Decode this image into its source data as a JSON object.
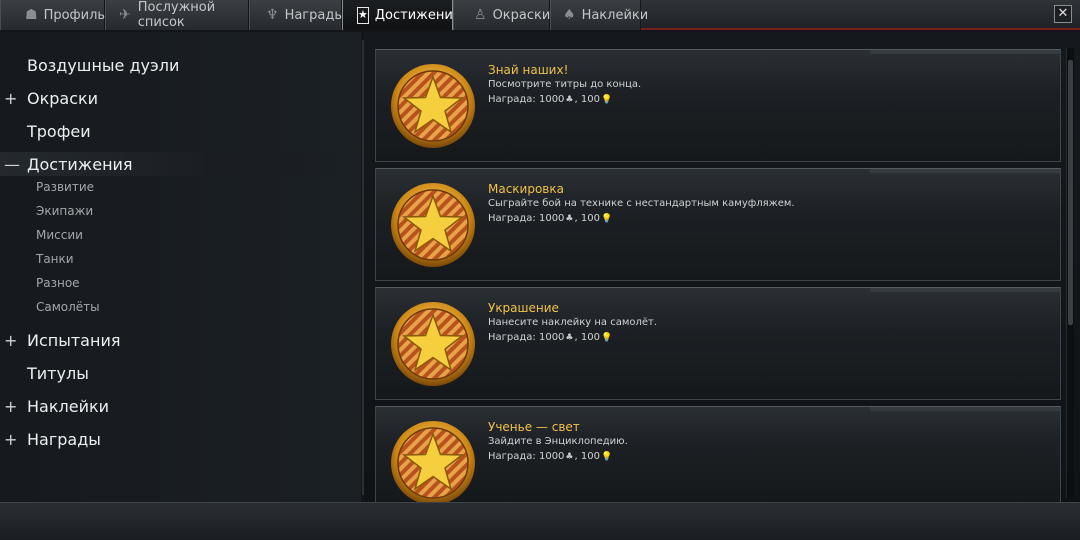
{
  "tabs": [
    {
      "label": "Профиль",
      "icon": "soldier-icon",
      "glyph": "☗"
    },
    {
      "label": "Послужной список",
      "icon": "aircraft-icon",
      "glyph": "✈"
    },
    {
      "label": "Награды",
      "icon": "goblet-icon",
      "glyph": "♆"
    },
    {
      "label": "Достижения",
      "icon": "star-icon",
      "glyph": "★"
    },
    {
      "label": "Окраски",
      "icon": "brush-icon",
      "glyph": "♙"
    },
    {
      "label": "Наклейки",
      "icon": "decal-icon",
      "glyph": "♠"
    }
  ],
  "active_tab": "Достижения",
  "close_glyph": "✕",
  "nav": [
    {
      "toggle": "",
      "label": "Воздушные дуэли"
    },
    {
      "toggle": "+",
      "label": "Окраски"
    },
    {
      "toggle": "",
      "label": "Трофеи"
    },
    {
      "toggle": "—",
      "label": "Достижения"
    },
    {
      "toggle": "+",
      "label": "Испытания"
    },
    {
      "toggle": "",
      "label": "Титулы"
    },
    {
      "toggle": "+",
      "label": "Наклейки"
    },
    {
      "toggle": "+",
      "label": "Награды"
    }
  ],
  "subnav": [
    "Развитие",
    "Экипажи",
    "Миссии",
    "Танки",
    "Разное",
    "Самолёты"
  ],
  "achievements": [
    {
      "title": "Знай наших!",
      "description": "Посмотрите титры до конца.",
      "reward_prefix": "Награда: 1000",
      "reward_mid": ", 100"
    },
    {
      "title": "Маскировка",
      "description": "Сыграйте бой на технике с нестандартным камуфляжем.",
      "reward_prefix": "Награда: 1000",
      "reward_mid": ", 100"
    },
    {
      "title": "Украшение",
      "description": "Нанесите наклейку на самолёт.",
      "reward_prefix": "Награда: 1000",
      "reward_mid": ", 100"
    },
    {
      "title": "Ученье — свет",
      "description": "Зайдите в Энциклопедию.",
      "reward_prefix": "Награда: 1000",
      "reward_mid": ", 100"
    }
  ],
  "reward_glyphs": {
    "experience": "♣",
    "bulb": "💡"
  },
  "colors": {
    "title": "#f2c14a",
    "tab_accent": "#7a1d1d",
    "medal_gold": "#e0a020"
  }
}
